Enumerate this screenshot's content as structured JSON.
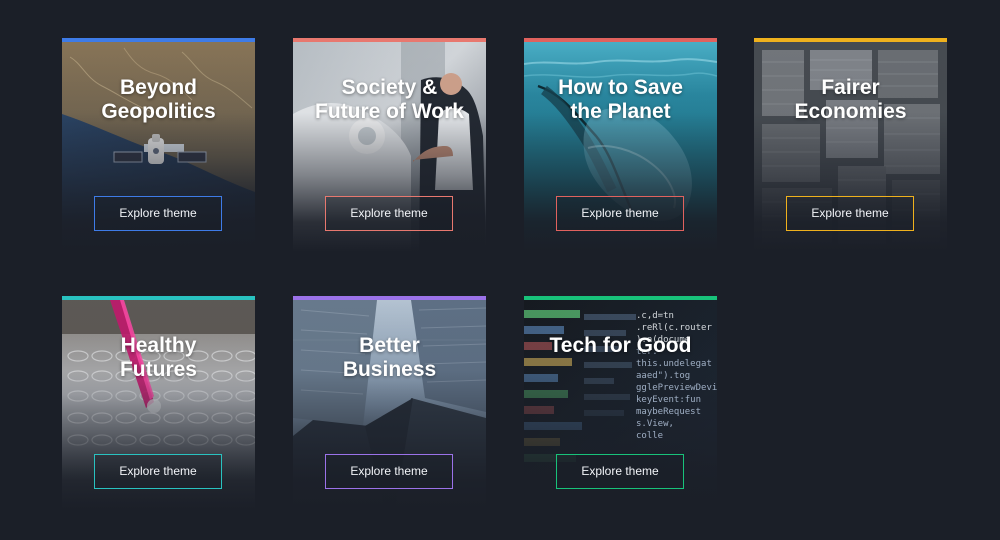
{
  "themes": [
    {
      "title": "Beyond\nGeopolitics",
      "button": "Explore theme",
      "accent_color": "#3e7be7",
      "image": "satellite-over-earth"
    },
    {
      "title": "Society &\nFuture of Work",
      "button": "Explore theme",
      "accent_color": "#e8786f",
      "image": "robot-and-businessman"
    },
    {
      "title": "How to Save\nthe Planet",
      "button": "Explore theme",
      "accent_color": "#e0625e",
      "image": "plastic-bottle-in-ocean"
    },
    {
      "title": "Fairer\nEconomies",
      "button": "Explore theme",
      "accent_color": "#efb11d",
      "image": "aerial-housing-block"
    },
    {
      "title": "Healthy\nFutures",
      "button": "Explore theme",
      "accent_color": "#29c2c0",
      "image": "lab-sample-tubes"
    },
    {
      "title": "Better\nBusiness",
      "button": "Explore theme",
      "accent_color": "#9b72e9",
      "image": "skyscrapers-looking-up"
    },
    {
      "title": "Tech for Good",
      "button": "Explore theme",
      "accent_color": "#18c27a",
      "image": "source-code-screen"
    }
  ]
}
